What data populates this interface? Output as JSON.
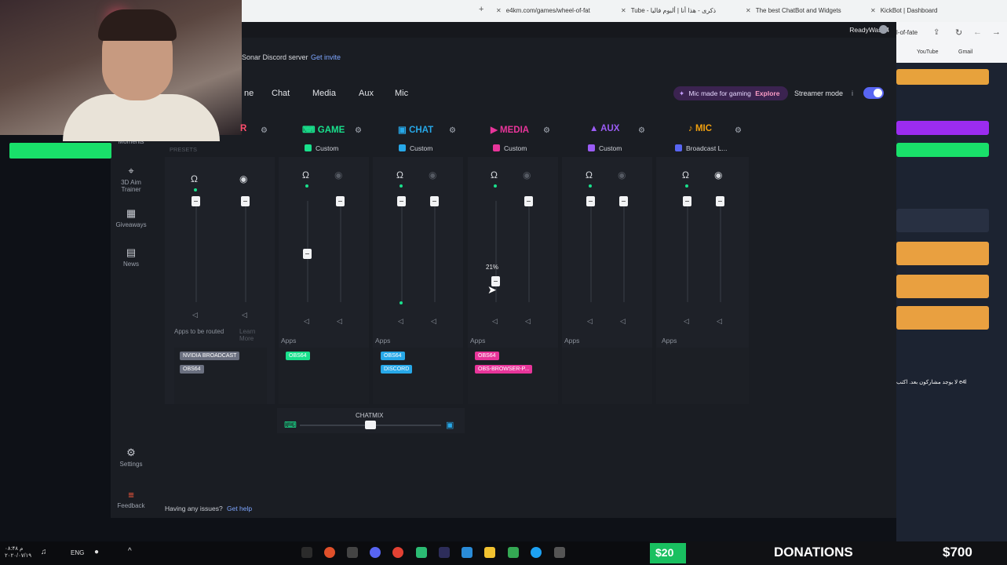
{
  "browser": {
    "tabs": [
      {
        "label": "e4km.com/games/wheel-of-fat"
      },
      {
        "label": "Tube - ذكرى - هذا أنا | ألبوم فاليا"
      },
      {
        "label": "The best ChatBot and Widgets"
      },
      {
        "label": "KickBot | Dashboard"
      }
    ],
    "address_tail": "l-of-fate",
    "bookmarks": [
      "YouTube",
      "Gmail"
    ]
  },
  "app": {
    "username": "ReadyWash4",
    "discord_text": "Sonar Discord server",
    "discord_link": "Get invite",
    "nav_tabs": [
      "ne",
      "Chat",
      "Media",
      "Aux",
      "Mic"
    ],
    "promo": {
      "text": "Mic made for gaming",
      "link": "Explore"
    },
    "streamer_mode": "Streamer mode",
    "info": "i",
    "presets_label": "PRESETS",
    "sidebar": [
      {
        "label": "Moments",
        "icon": "moments-icon"
      },
      {
        "label": "3D Aim Trainer",
        "icon": "aim-icon"
      },
      {
        "label": "Giveaways",
        "icon": "gift-icon"
      },
      {
        "label": "News",
        "icon": "news-icon"
      },
      {
        "label": "Settings",
        "icon": "gear-icon"
      },
      {
        "label": "Feedback",
        "icon": "feedback-icon"
      }
    ],
    "channels": [
      {
        "name": "R",
        "preset": "",
        "color": "#ff4d6d",
        "apps_label": "Apps to be routed",
        "learn": "Learn More",
        "apps": [
          {
            "name": "NVIDIA BROADCAST",
            "color": "#6b7080"
          },
          {
            "name": "OBS64",
            "color": "#6b7080"
          }
        ],
        "main_level": 1.0,
        "stream_level": 1.0
      },
      {
        "name": "GAME",
        "preset": "Custom",
        "color": "#19e08c",
        "apps_label": "Apps",
        "apps": [
          {
            "name": "OBS64",
            "color": "#19e08c"
          }
        ],
        "main_level": 0.48,
        "stream_level": 1.0
      },
      {
        "name": "CHAT",
        "preset": "Custom",
        "color": "#27a8e8",
        "apps_label": "Apps",
        "apps": [
          {
            "name": "OBS64",
            "color": "#27a8e8"
          },
          {
            "name": "DISCORD",
            "color": "#27a8e8"
          }
        ],
        "main_level": 1.0,
        "stream_level": 1.0
      },
      {
        "name": "MEDIA",
        "preset": "Custom",
        "color": "#e8359a",
        "apps_label": "Apps",
        "apps": [
          {
            "name": "OBS64",
            "color": "#e8359a"
          },
          {
            "name": "OBS-BROWSER-P...",
            "color": "#e8359a"
          }
        ],
        "main_level": 0.21,
        "stream_level": 1.0,
        "tooltip": "21%"
      },
      {
        "name": "AUX",
        "preset": "Custom",
        "color": "#9b5cf5",
        "apps_label": "Apps",
        "apps": [],
        "main_level": 1.0,
        "stream_level": 1.0
      },
      {
        "name": "MIC",
        "preset": "Broadcast L...",
        "color": "#f0a010",
        "apps_label": "Apps",
        "apps": [],
        "main_level": 1.0,
        "stream_level": 1.0
      }
    ],
    "chatmix": {
      "label": "CHATMIX",
      "level": 0.5
    },
    "help": {
      "text": "Having any issues?",
      "link": "Get help"
    }
  },
  "right_site": {
    "text": "لا يوجد مشاركون بعد. اكتب e4l"
  },
  "taskbar": {
    "time": "۰۸:۴۸ م",
    "date": "۲۰۲۰/۰۷/۱۹",
    "lang": "ENG",
    "donation_amount_small": "$20",
    "donations_label": "DONATIONS",
    "donations_total": "$700"
  }
}
